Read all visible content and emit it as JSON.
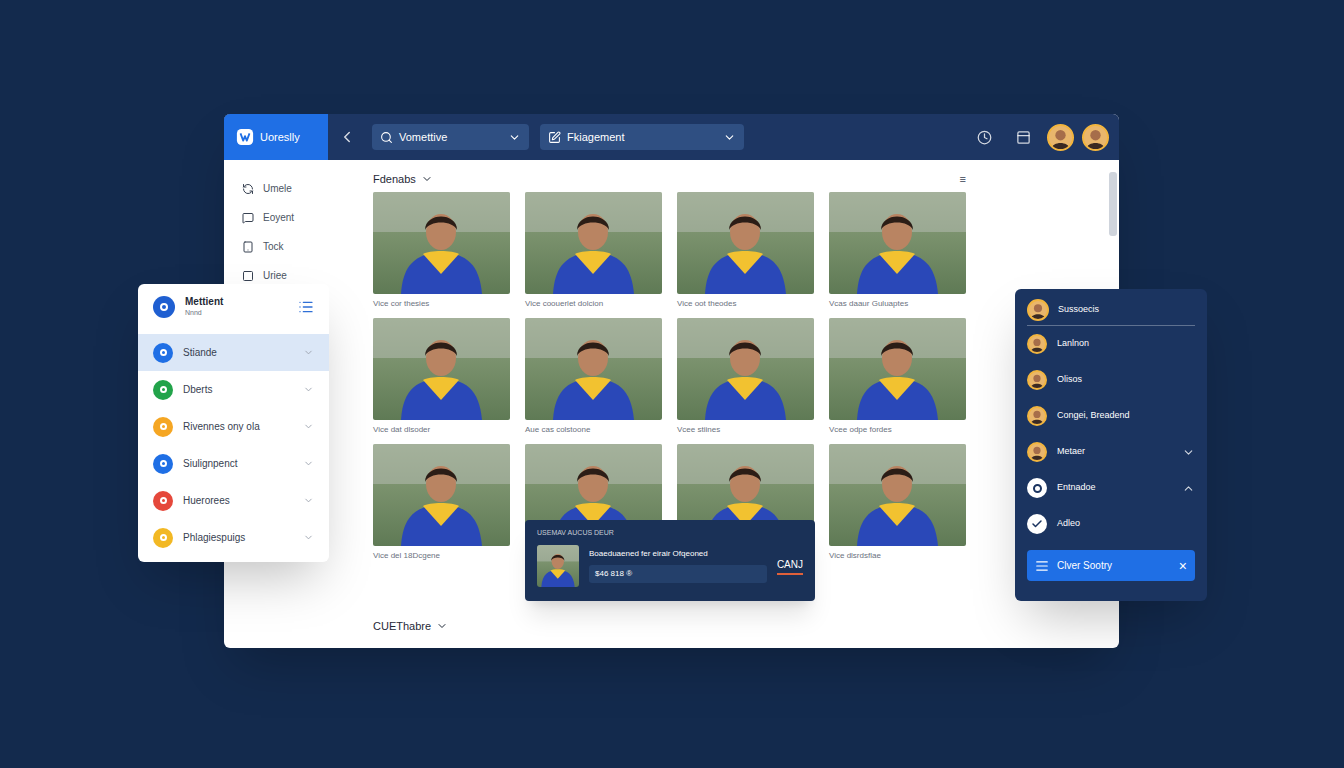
{
  "app": {
    "logo": "Uoreslly"
  },
  "toolbar": {
    "dropdowns": [
      {
        "label": "Vomettive"
      },
      {
        "label": "Fkiagement"
      }
    ]
  },
  "sidebar": {
    "items": [
      {
        "label": "Umele"
      },
      {
        "label": "Eoyent"
      },
      {
        "label": "Tock"
      },
      {
        "label": "Uriee"
      }
    ]
  },
  "gallery": {
    "title": "Fdenabs",
    "menu_glyph": "≡",
    "cards": [
      {
        "caption": "Vice cor thesies"
      },
      {
        "caption": "Vice coouerlet dolcion"
      },
      {
        "caption": "Vice oot theodes"
      },
      {
        "caption": "Vcas daaur Guluaptes"
      },
      {
        "caption": "Vice dat dlsoder"
      },
      {
        "caption": "Aue cas colstoone"
      },
      {
        "caption": "Vcee stiines"
      },
      {
        "caption": "Vcee odpe fordes"
      },
      {
        "caption": "Vice del 18Dcgene"
      },
      {},
      {},
      {
        "caption": "Vice dlsrdsflae"
      }
    ],
    "footer": "CUEThabre"
  },
  "popup": {
    "heading": "USEMAV AUCUS DEUR",
    "text": "Boaeduaened fer eirair Ofqeoned",
    "meta": "$46 818 ®",
    "action": "CANJ"
  },
  "left_panel": {
    "title": "Mettient",
    "subtitle": "Nnnd",
    "items": [
      {
        "label": "Stiande",
        "color": "#1f6fe5",
        "selected": true
      },
      {
        "label": "Dberts",
        "color": "#22a34a",
        "selected": false
      },
      {
        "label": "Rivennes ony ola",
        "color": "#f5a623",
        "selected": false
      },
      {
        "label": "Siulignpenct",
        "color": "#1f6fe5",
        "selected": false
      },
      {
        "label": "Huerorees",
        "color": "#e5483b",
        "selected": false
      },
      {
        "label": "Phlagiespuigs",
        "color": "#f2b824",
        "selected": false
      }
    ]
  },
  "right_panel": {
    "header": {
      "label": "Sussoecis"
    },
    "items": [
      {
        "label": "Lanlnon",
        "kind": "person"
      },
      {
        "label": "Olisos",
        "kind": "person"
      },
      {
        "label": "Congei, Breadend",
        "kind": "person"
      },
      {
        "label": "Metaer",
        "kind": "person",
        "expanded": false
      },
      {
        "label": "Entnadoe",
        "kind": "ring",
        "expanded": true
      },
      {
        "label": "Adleo",
        "kind": "check"
      }
    ],
    "button": {
      "label": "Clver Sootry",
      "close": "×"
    }
  }
}
